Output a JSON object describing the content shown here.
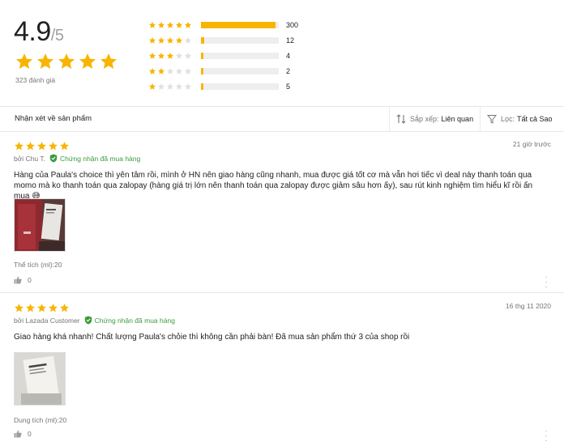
{
  "summary": {
    "score": "4.9",
    "max": "/5",
    "rating_count_label": "323 đánh giá",
    "stars_filled": 5,
    "distribution": [
      {
        "stars": 5,
        "count": "300",
        "fraction": 0.96
      },
      {
        "stars": 4,
        "count": "12",
        "fraction": 0.04
      },
      {
        "stars": 3,
        "count": "4",
        "fraction": 0.01
      },
      {
        "stars": 2,
        "count": "2",
        "fraction": 0.005
      },
      {
        "stars": 1,
        "count": "5",
        "fraction": 0.015
      }
    ]
  },
  "toolbar": {
    "title": "Nhận xét về sản phẩm",
    "sort_label": "Sắp xếp:",
    "sort_value": "Liên quan",
    "filter_label": "Lọc:",
    "filter_value": "Tất cả Sao"
  },
  "reviews": [
    {
      "stars": 5,
      "date": "21 giờ trước",
      "author": "bởi Chu T.",
      "verified": "Chứng nhận đã mua hàng",
      "text": "Hàng của Paula's choice thì yên tâm rồi, mình ở HN nên giao hàng cũng nhanh, mua được giá tốt cơ mà vẫn hơi tiếc vì deal này thanh toán qua momo mà ko thanh toán qua zalopay (hàng giá trị lớn nên thanh toán qua zalopay được giảm sâu hơn ấy), sau rút kinh nghiệm tìm hiểu kĩ rồi ấn mua 😅",
      "sku": "Thể tích (ml):20",
      "likes": "0"
    },
    {
      "stars": 5,
      "date": "16 thg 11 2020",
      "author": "bởi Lazada Customer",
      "verified": "Chứng nhận đã mua hàng",
      "text": "Giao hàng khá nhanh! Chất lượng Paula's chỏie thì không cần phải bàn! Đã mua sản phẩm thứ 3 của shop rồi",
      "sku": "Dung tích (ml):20",
      "likes": "0"
    }
  ],
  "colors": {
    "star": "#f7b500",
    "star_empty": "#e0e0e0",
    "verified": "#3c9b3c"
  }
}
